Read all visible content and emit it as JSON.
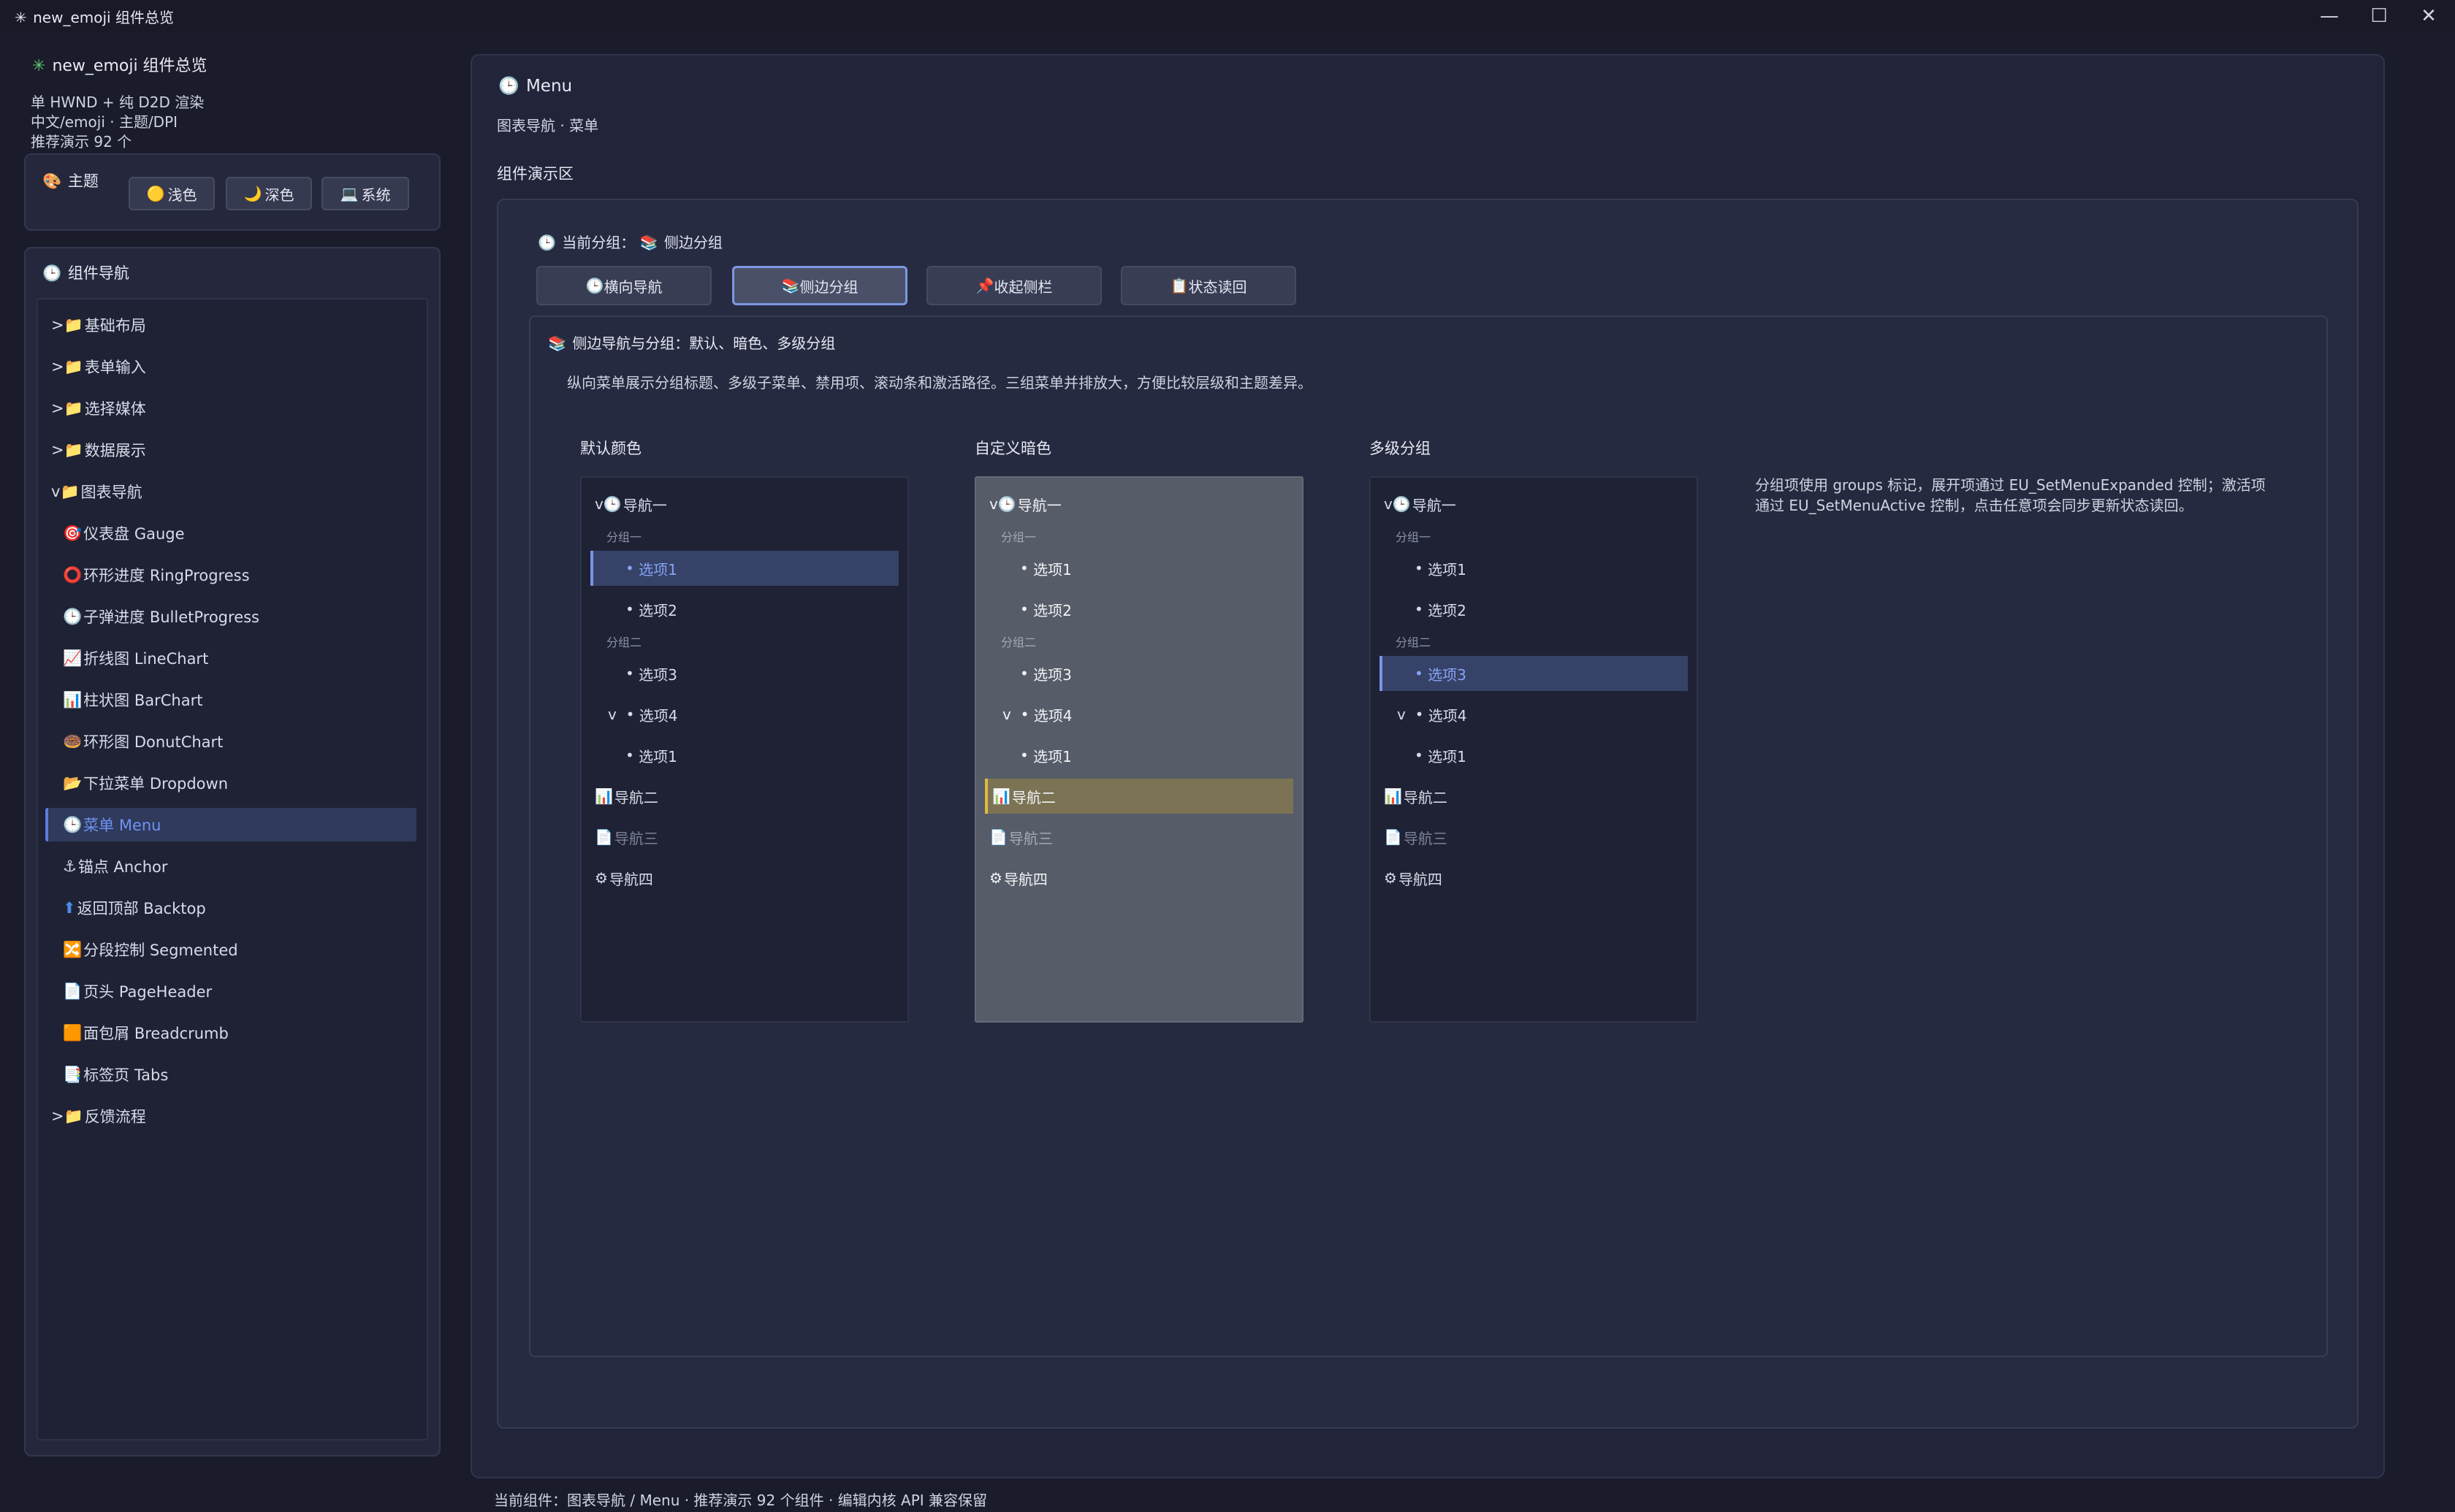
{
  "window": {
    "title": "new_emoji 组件总览",
    "controls": {
      "minimize": "—",
      "maximize": "☐",
      "close": "✕"
    }
  },
  "sidebar": {
    "app_title": "new_emoji 组件总览",
    "info": [
      "单 HWND + 纯 D2D 渲染",
      "中文/emoji · 主题/DPI",
      "推荐演示 92 个"
    ],
    "theme": {
      "label": "主题",
      "buttons": [
        {
          "icon": "🟡",
          "label": "浅色"
        },
        {
          "icon": "🌙",
          "label": "深色"
        },
        {
          "icon": "💻",
          "label": "系统"
        }
      ]
    },
    "nav": {
      "title": "组件导航",
      "items": [
        {
          "prefix": ">",
          "icon": "📁",
          "label": "基础布局"
        },
        {
          "prefix": ">",
          "icon": "📁",
          "label": "表单输入"
        },
        {
          "prefix": ">",
          "icon": "📁",
          "label": "选择媒体"
        },
        {
          "prefix": ">",
          "icon": "📁",
          "label": "数据展示"
        },
        {
          "prefix": "v",
          "icon": "📁",
          "label": "图表导航"
        },
        {
          "prefix": "",
          "icon": "🎯",
          "label": "仪表盘 Gauge"
        },
        {
          "prefix": "",
          "icon": "⭕",
          "label": "环形进度 RingProgress"
        },
        {
          "prefix": "",
          "icon": "🕒",
          "label": "子弹进度 BulletProgress"
        },
        {
          "prefix": "",
          "icon": "📈",
          "label": "折线图 LineChart"
        },
        {
          "prefix": "",
          "icon": "📊",
          "label": "柱状图 BarChart"
        },
        {
          "prefix": "",
          "icon": "🍩",
          "label": "环形图 DonutChart"
        },
        {
          "prefix": "",
          "icon": "📂",
          "label": "下拉菜单 Dropdown"
        },
        {
          "prefix": "",
          "icon": "🕒",
          "label": "菜单 Menu"
        },
        {
          "prefix": "",
          "icon": "⚓",
          "label": "锚点 Anchor"
        },
        {
          "prefix": "",
          "icon": "⬆",
          "label": "返回顶部 Backtop"
        },
        {
          "prefix": "",
          "icon": "🔀",
          "label": "分段控制 Segmented"
        },
        {
          "prefix": "",
          "icon": "📄",
          "label": "页头 PageHeader"
        },
        {
          "prefix": "",
          "icon": "🟧",
          "label": "面包屑 Breadcrumb"
        },
        {
          "prefix": "",
          "icon": "📑",
          "label": "标签页 Tabs"
        },
        {
          "prefix": ">",
          "icon": "📁",
          "label": "反馈流程"
        }
      ]
    }
  },
  "main": {
    "title": "Menu",
    "subtitle": "图表导航 · 菜单",
    "demo_label": "组件演示区",
    "current_group_prefix": "当前分组：",
    "current_group": "侧边分组",
    "tabs": [
      {
        "icon": "🕒",
        "label": "横向导航"
      },
      {
        "icon": "📚",
        "label": "侧边分组"
      },
      {
        "icon": "📌",
        "label": "收起侧栏"
      },
      {
        "icon": "📋",
        "label": "状态读回"
      }
    ],
    "section_title": "侧边导航与分组：默认、暗色、多级分组",
    "section_desc": "纵向菜单展示分组标题、多级子菜单、禁用项、滚动条和激活路径。三组菜单并排放大，方便比较层级和主题差异。",
    "columns": [
      {
        "title": "默认颜色"
      },
      {
        "title": "自定义暗色"
      },
      {
        "title": "多级分组"
      }
    ],
    "menu": {
      "nav1": "导航一",
      "group1": "分组一",
      "opt1": "选项1",
      "opt2": "选项2",
      "group2": "分组二",
      "opt3": "选项3",
      "opt4": "选项4",
      "sub_opt1": "选项1",
      "nav2": "导航二",
      "nav3": "导航三",
      "nav4": "导航四"
    },
    "note": "分组项使用 groups 标记，展开项通过 EU_SetMenuExpanded 控制；激活项通过 EU_SetMenuActive 控制，点击任意项会同步更新状态读回。"
  },
  "status_bar": "当前组件：图表导航 / Menu · 推荐演示 92 个组件 · 编辑内核 API 兼容保留",
  "colors": {
    "background": "#1a1c2b",
    "accent": "#7a94e6",
    "gold_active": "#e2b940"
  }
}
